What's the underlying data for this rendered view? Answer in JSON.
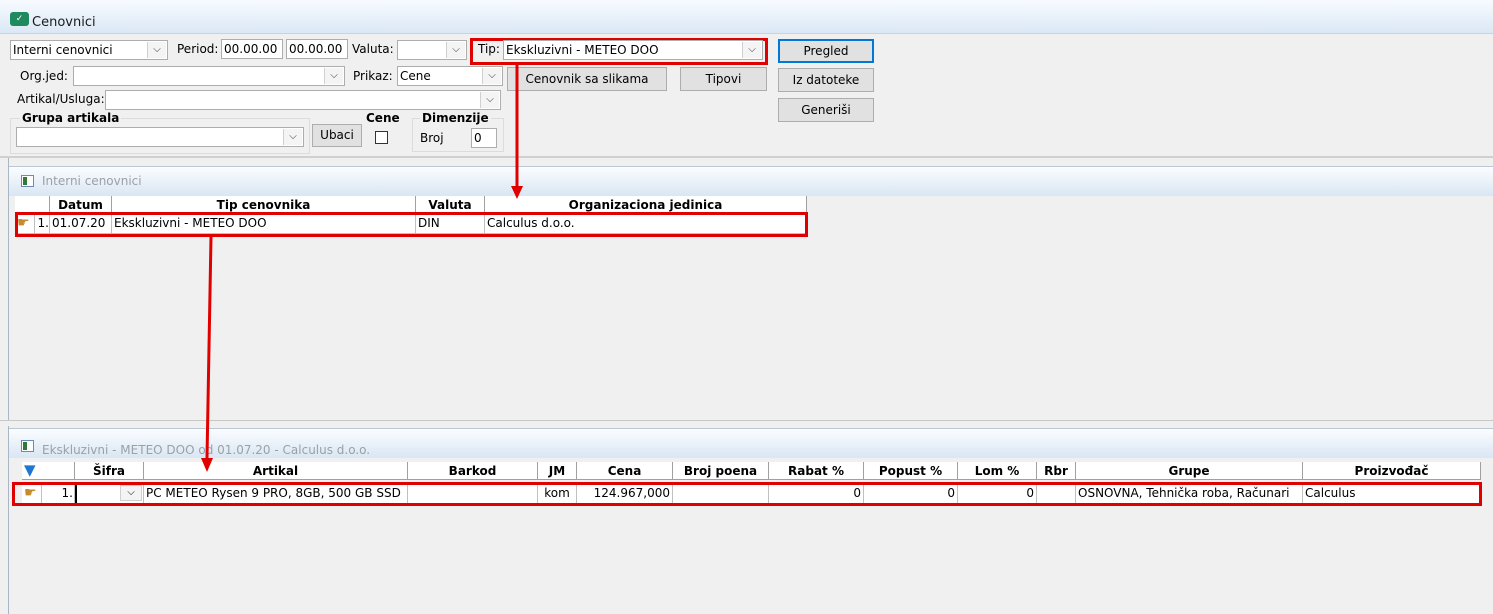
{
  "window": {
    "title": "Cenovnici",
    "icon": "price-list-app-icon"
  },
  "filters": {
    "list_type": "Interni cenovnici",
    "period_label": "Period:",
    "period_from": "00.00.00",
    "period_to": "00.00.00",
    "valuta_label": "Valuta:",
    "valuta_value": "",
    "tip_label": "Tip:",
    "tip_value": "Ekskluzivni - METEO DOO",
    "orgjed_label": "Org.jed:",
    "orgjed_value": "",
    "prikaz_label": "Prikaz:",
    "prikaz_value": "Cene",
    "artikal_label": "Artikal/Usluga:",
    "artikal_value": "",
    "grupa_title": "Grupa artikala",
    "grupa_value": "",
    "ubaci_label": "Ubaci",
    "cene_title": "Cene",
    "dimenzije_title": "Dimenzije",
    "broj_label": "Broj",
    "broj_value": "0"
  },
  "buttons": {
    "pregled": "Pregled",
    "iz_datoteke": "Iz datoteke",
    "generisi": "Generiši",
    "cenovnik_sa_slikama": "Cenovnik sa slikama",
    "tipovi": "Tipovi"
  },
  "panel1": {
    "title": "Interni cenovnici",
    "columns": [
      "Datum",
      "Tip cenovnika",
      "Valuta",
      "Organizaciona jedinica"
    ],
    "rows": [
      {
        "num": "1.",
        "datum": "01.07.20",
        "tip": "Ekskluzivni - METEO DOO",
        "valuta": "DIN",
        "org": "Calculus d.o.o."
      }
    ]
  },
  "panel2": {
    "title": "Ekskluzivni - METEO DOO od 01.07.20 - Calculus d.o.o.",
    "columns": [
      "Šifra",
      "Artikal",
      "Barkod",
      "JM",
      "Cena",
      "Broj poena",
      "Rabat %",
      "Popust %",
      "Lom %",
      "Rbr",
      "Grupe",
      "Proizvođač"
    ],
    "rows": [
      {
        "num": "1.",
        "sifra": "",
        "artikal": "PC METEO Rysen 9 PRO, 8GB, 500 GB SSD",
        "barkod": "",
        "jm": "kom",
        "cena": "124.967,000",
        "broj_poena": "",
        "rabat": "0",
        "popust": "0",
        "lom": "0",
        "rbr": "",
        "grupe": "OSNOVNA, Tehnička roba, Računari",
        "proizvodjac": "Calculus"
      }
    ]
  },
  "colors": {
    "highlight": "#e00000",
    "accent": "#0078d7"
  }
}
